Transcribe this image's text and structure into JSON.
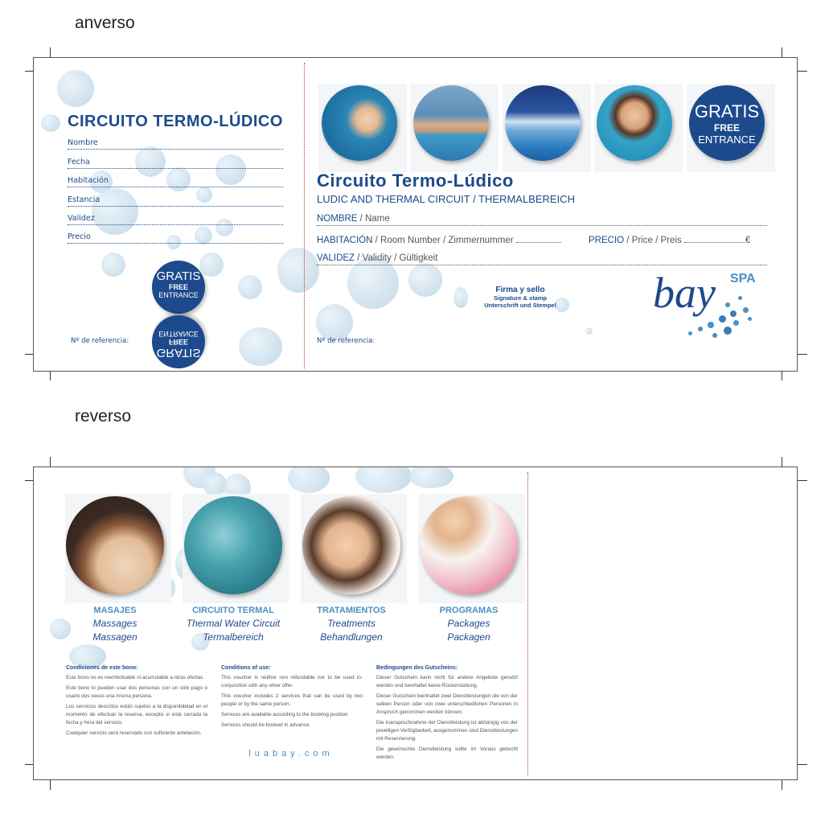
{
  "labels": {
    "front": "anverso",
    "back": "reverso"
  },
  "stub": {
    "title": "CIRCUITO TERMO-LÚDICO",
    "fields": [
      "Nombre",
      "Fecha",
      "Habitación",
      "Estancia",
      "Validez",
      "Precio"
    ],
    "reference": "Nº de referencia:"
  },
  "badge": {
    "gratis": "GRATIS",
    "free": "FREE",
    "entrance": "ENTRANCE"
  },
  "main": {
    "title": "Circuito Termo-Lúdico",
    "subtitle": "LUDIC AND THERMAL CIRCUIT / THERMALBEREICH",
    "name_label": "NOMBRE",
    "name_sub": " / Name ",
    "room_label": "HABITACIÓN",
    "room_sub": " / Room Number / Zimmernummer ",
    "price_label": "PRECIO",
    "price_sub": " / Price / Preis ",
    "price_currency": "€",
    "validity_label": "VALIDEZ",
    "validity_sub": " / Validity / Gültigkeit ",
    "sign_title": "Firma y sello",
    "sign_line2": "Signature & stamp",
    "sign_line3": "Unterschrift und Stempel",
    "reference": "Nº de referencia:",
    "logo_bay": "bay",
    "logo_spa": "SPA"
  },
  "services": [
    {
      "es": "MASAJES",
      "en": "Massages",
      "de": "Massagen"
    },
    {
      "es": "CIRCUITO TERMAL",
      "en": "Thermal Water Circuit",
      "de": "Termalbereich"
    },
    {
      "es": "TRATAMIENTOS",
      "en": "Treatments",
      "de": "Behandlungen"
    },
    {
      "es": "PROGRAMAS",
      "en": "Packages",
      "de": "Packagen"
    }
  ],
  "conditions": {
    "es": {
      "title": "Condiciones de este bono:",
      "lines": [
        "Este bono no es reembolsable ni acumulable a otras ofertas.",
        "Este bono lo pueden usar dos personas con un sólo pago o usarlo dos veces una misma persona.",
        "Los servicios descritos están sujetos a la disponibilidad en el momento de efectuar la reserva, excepto si está cerrada la fecha y hora del servicio.",
        "Cualquier servicio será reservado con suficiente antelación."
      ]
    },
    "en": {
      "title": "Conditions of use:",
      "lines": [
        "This voucher is neither non refundable nor to be used in-conjunction with any other offer.",
        "This voucher includes 2 services that can be used by two people or by the same person.",
        "Services are available according to the booking position",
        "Services should be booked in advance."
      ]
    },
    "de": {
      "title": "Bedingungen des Gutscheins:",
      "lines": [
        "Dieser Gutschein kann nicht für andere Angebote genutzt werden und beinhaltet keine Rückerstattung.",
        "Dieser Gutschein beinhaltet zwei Dienstleistungen die von der selben Person oder von zwei unterschiedlichen Personen in Anspruch genommen werden können.",
        "Die Inanspruchnahme der Dienstleistung ist abhängig von der jeweiligen Verfügbarkeit, ausgenommen sind Dienstleistungen mit Reservierung.",
        "Die gewünschte Dienstleistung sollte im Voraus gebucht werden."
      ]
    }
  },
  "website": "luabay.com",
  "colors": {
    "brand": "#1c4a8c",
    "accent": "#4a90c6",
    "bubble": "#c7dcea"
  }
}
